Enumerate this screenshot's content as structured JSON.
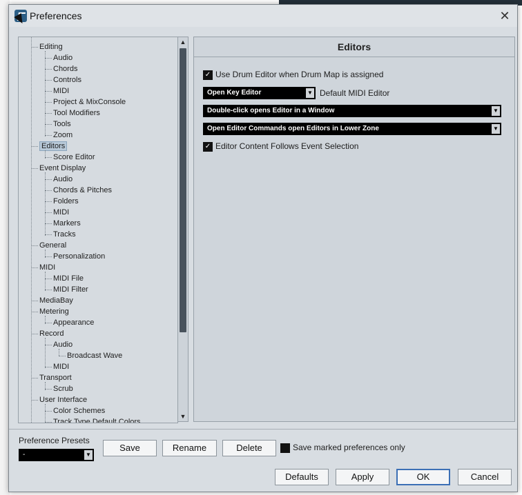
{
  "window": {
    "title": "Preferences",
    "close_glyph": "✕"
  },
  "tree": {
    "items": [
      {
        "label": "Editing",
        "level": 0
      },
      {
        "label": "Audio",
        "level": 1
      },
      {
        "label": "Chords",
        "level": 1
      },
      {
        "label": "Controls",
        "level": 1
      },
      {
        "label": "MIDI",
        "level": 1
      },
      {
        "label": "Project & MixConsole",
        "level": 1
      },
      {
        "label": "Tool Modifiers",
        "level": 1
      },
      {
        "label": "Tools",
        "level": 1
      },
      {
        "label": "Zoom",
        "level": 1
      },
      {
        "label": "Editors",
        "level": 0,
        "selected": true
      },
      {
        "label": "Score Editor",
        "level": 1
      },
      {
        "label": "Event Display",
        "level": 0
      },
      {
        "label": "Audio",
        "level": 1
      },
      {
        "label": "Chords & Pitches",
        "level": 1
      },
      {
        "label": "Folders",
        "level": 1
      },
      {
        "label": "MIDI",
        "level": 1
      },
      {
        "label": "Markers",
        "level": 1
      },
      {
        "label": "Tracks",
        "level": 1
      },
      {
        "label": "General",
        "level": 0
      },
      {
        "label": "Personalization",
        "level": 1
      },
      {
        "label": "MIDI",
        "level": 0
      },
      {
        "label": "MIDI File",
        "level": 1
      },
      {
        "label": "MIDI Filter",
        "level": 1
      },
      {
        "label": "MediaBay",
        "level": 0
      },
      {
        "label": "Metering",
        "level": 0
      },
      {
        "label": "Appearance",
        "level": 1
      },
      {
        "label": "Record",
        "level": 0
      },
      {
        "label": "Audio",
        "level": 1
      },
      {
        "label": "Broadcast Wave",
        "level": 2
      },
      {
        "label": "MIDI",
        "level": 1
      },
      {
        "label": "Transport",
        "level": 0
      },
      {
        "label": "Scrub",
        "level": 1
      },
      {
        "label": "User Interface",
        "level": 0
      },
      {
        "label": "Color Schemes",
        "level": 1
      },
      {
        "label": "Track Type Default Colors",
        "level": 1
      }
    ],
    "scroll_up": "▲",
    "scroll_down": "▼"
  },
  "editors": {
    "title": "Editors",
    "use_drum_editor_label": "Use Drum Editor when Drum Map is assigned",
    "use_drum_editor_checked": true,
    "default_editor_value": "Open Key Editor",
    "default_editor_label": "Default MIDI Editor",
    "double_click_value": "Double-click opens Editor in a Window",
    "commands_value": "Open Editor Commands open Editors in Lower Zone",
    "follows_selection_label": "Editor Content Follows Event Selection",
    "follows_selection_checked": true,
    "check_glyph": "✓",
    "dropdown_glyph": "▼"
  },
  "presets": {
    "label": "Preference Presets",
    "selected": "-",
    "save": "Save",
    "rename": "Rename",
    "delete": "Delete",
    "save_marked_label": "Save marked preferences only"
  },
  "footer": {
    "defaults": "Defaults",
    "apply": "Apply",
    "ok": "OK",
    "cancel": "Cancel"
  }
}
